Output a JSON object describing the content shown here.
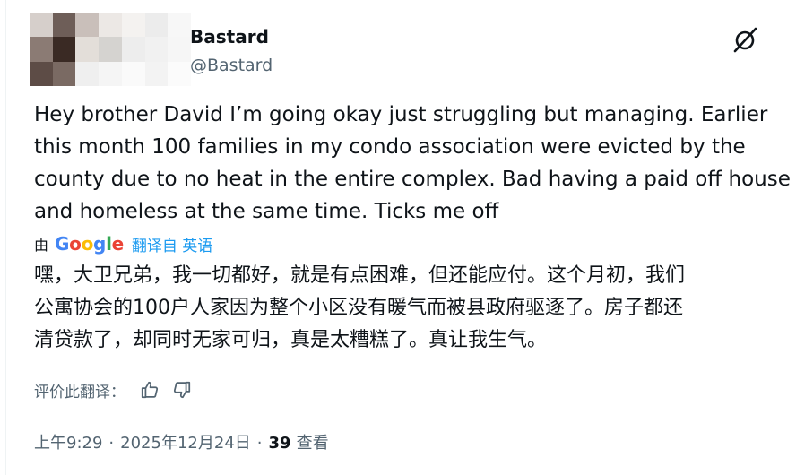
{
  "author": {
    "display_name": "Bastard",
    "handle": "@Bastard",
    "avatar_colors": [
      "#d6cfcb",
      "#6e5e58",
      "#c9bfba",
      "#ece8e5",
      "#f4f2f0",
      "#ececec",
      "#f7f7f7",
      "#8b7b74",
      "#3a2a24",
      "#e3ded9",
      "#d5d3d0",
      "#ededed",
      "#f1f1f1",
      "#f6f6f6",
      "#5d4c46",
      "#7a6a63",
      "#efefef",
      "#f5f5f5",
      "#fafafa",
      "#f3f3f3",
      "#fbfbfb"
    ]
  },
  "grok_icon": "grok-slash-icon",
  "post_text": "Hey brother David I’m going okay just struggling but managing. Earlier\nthis month 100 families in my condo association were evicted by the\ncounty due to no heat in the entire complex. Bad having a paid off house\nand homeless at the same time. Ticks me off",
  "translation": {
    "by_label": "由",
    "google_letters": [
      {
        "ch": "G",
        "color": "#4285f4"
      },
      {
        "ch": "o",
        "color": "#ea4335"
      },
      {
        "ch": "o",
        "color": "#fbbc05"
      },
      {
        "ch": "g",
        "color": "#4285f4"
      },
      {
        "ch": "l",
        "color": "#34a853"
      },
      {
        "ch": "e",
        "color": "#ea4335"
      }
    ],
    "translated_from": "翻译自 英语",
    "text": "嘿，大卫兄弟，我一切都好，就是有点困难，但还能应付。这个月初，我们\n公寓协会的100户人家因为整个小区没有暖气而被县政府驱逐了。房子都还\n清贷款了，却同时无家可归，真是太糟糕了。真让我生气。"
  },
  "rating": {
    "label": "评价此翻译：",
    "thumbs_up_icon": "thumbs-up-icon",
    "thumbs_down_icon": "thumbs-down-icon"
  },
  "meta": {
    "time": "上午9:29",
    "separator": "·",
    "date": "2025年12月24日",
    "views_count": "39",
    "views_label": "查看"
  }
}
